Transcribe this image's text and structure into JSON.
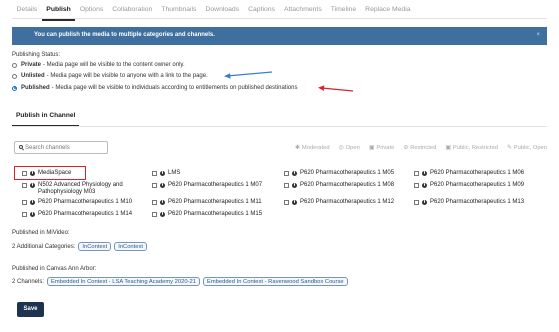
{
  "tabs": [
    "Details",
    "Publish",
    "Options",
    "Collaboration",
    "Thumbnails",
    "Downloads",
    "Captions",
    "Attachments",
    "Timeline",
    "Replace Media"
  ],
  "active_tab": "Publish",
  "banner": {
    "text": "You can publish the media to multiple categories and channels.",
    "close": "×"
  },
  "publishing_status": {
    "label": "Publishing Status:",
    "options": [
      {
        "name": "Private",
        "desc": "- Media page will be visible to the content owner only.",
        "checked": false
      },
      {
        "name": "Unlisted",
        "desc": "- Media page will be visible to anyone with a link to the page.",
        "checked": false
      },
      {
        "name": "Published",
        "desc": "- Media page will be visible to individuals according to entitlements on published destinations",
        "checked": true
      }
    ]
  },
  "channel_tab": "Publish in Channel",
  "search": {
    "placeholder": "Search channels"
  },
  "filters": [
    "Moderated",
    "Open",
    "Private",
    "Restricted",
    "Public, Restricted",
    "Public, Open"
  ],
  "channels": [
    "MediaSpace",
    "LMS",
    "P620 Pharmacotherapeutics 1 M05",
    "P620 Pharmacotherapeutics 1 M06",
    "N502 Advanced Physiology and Pathophysiology M03",
    "P620 Pharmacotherapeutics 1 M07",
    "P620 Pharmacotherapeutics 1 M08",
    "P620 Pharmacotherapeutics 1 M09",
    "P620 Pharmacotherapeutics 1 M10",
    "P620 Pharmacotherapeutics 1 M11",
    "P620 Pharmacotherapeutics 1 M12",
    "P620 Pharmacotherapeutics 1 M13",
    "P620 Pharmacotherapeutics 1 M14",
    "P620 Pharmacotherapeutics 1 M15"
  ],
  "mivideo": {
    "label": "Published in MiVideo:",
    "categories_label": "2 Additional Categories:",
    "categories": [
      "InContext",
      "InContext"
    ]
  },
  "canvas": {
    "label": "Published in Canvas Ann Arbor:",
    "channels_label": "2 Channels:",
    "channels": [
      "Embedded In Context - LSA Teaching Academy 2020-21",
      "Embedded In Context - Ravenwood Sandbox Course"
    ]
  },
  "save_label": "Save",
  "colors": {
    "accent": "#3f6f9f",
    "save": "#1c3352",
    "annotation_red": "#d9232c",
    "annotation_blue": "#3a7bd5"
  }
}
